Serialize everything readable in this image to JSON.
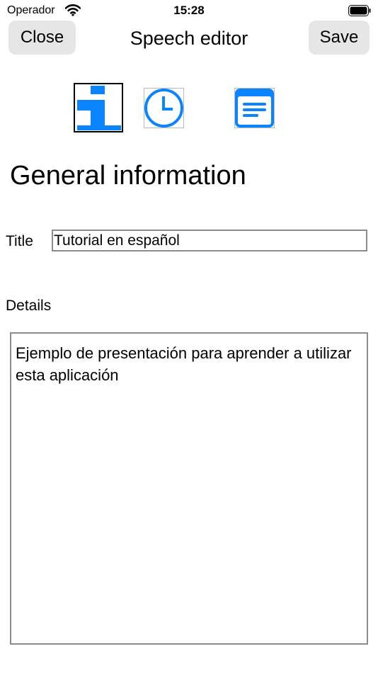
{
  "status_bar": {
    "carrier": "Operador",
    "time": "15:28",
    "wifi_icon": "wifi-icon",
    "battery_icon": "battery-icon"
  },
  "nav": {
    "close_label": "Close",
    "title": "Speech editor",
    "save_label": "Save"
  },
  "tabs": [
    {
      "name": "info",
      "icon": "info-icon",
      "selected": true
    },
    {
      "name": "time",
      "icon": "clock-icon",
      "selected": false
    },
    {
      "name": "notes",
      "icon": "notes-icon",
      "selected": false
    }
  ],
  "section": {
    "heading": "General information"
  },
  "form": {
    "title_label": "Title",
    "title_value": "Tutorial en español",
    "details_label": "Details",
    "details_value": "Ejemplo de presentación para aprender a utilizar esta aplicación"
  },
  "colors": {
    "accent": "#0a84ff",
    "button_bg": "#e6e6e6",
    "field_border": "#8c8c8c"
  }
}
